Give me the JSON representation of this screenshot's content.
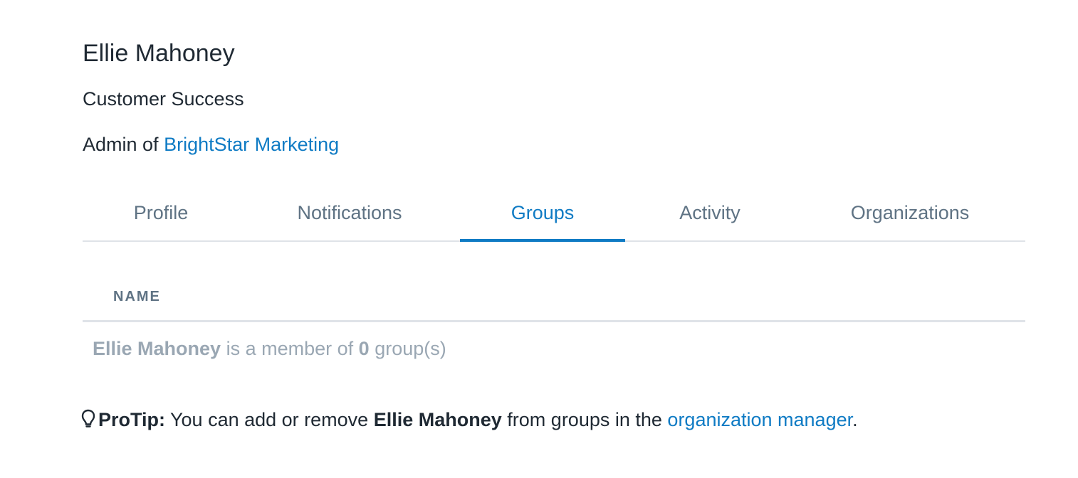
{
  "user": {
    "name": "Ellie Mahoney",
    "department": "Customer Success",
    "admin_prefix": "Admin of",
    "organization": "BrightStar Marketing"
  },
  "tabs": [
    {
      "label": "Profile",
      "active": false
    },
    {
      "label": "Notifications",
      "active": false
    },
    {
      "label": "Groups",
      "active": true
    },
    {
      "label": "Activity",
      "active": false
    },
    {
      "label": "Organizations",
      "active": false
    }
  ],
  "groups_table": {
    "column_header": "NAME",
    "empty": {
      "name": "Ellie Mahoney",
      "middle": "is a member of",
      "count": "0",
      "suffix": "group(s)"
    }
  },
  "protip": {
    "icon": "lightbulb-icon",
    "label": "ProTip:",
    "text_before": "You can add or remove",
    "name": "Ellie Mahoney",
    "text_middle": "from groups in the",
    "link": "organization manager",
    "text_after": "."
  },
  "colors": {
    "accent": "#0f7bc4",
    "text": "#1f2933",
    "muted": "#5f7384",
    "empty_text": "#9aa7b3",
    "divider": "#dfe3e8"
  }
}
